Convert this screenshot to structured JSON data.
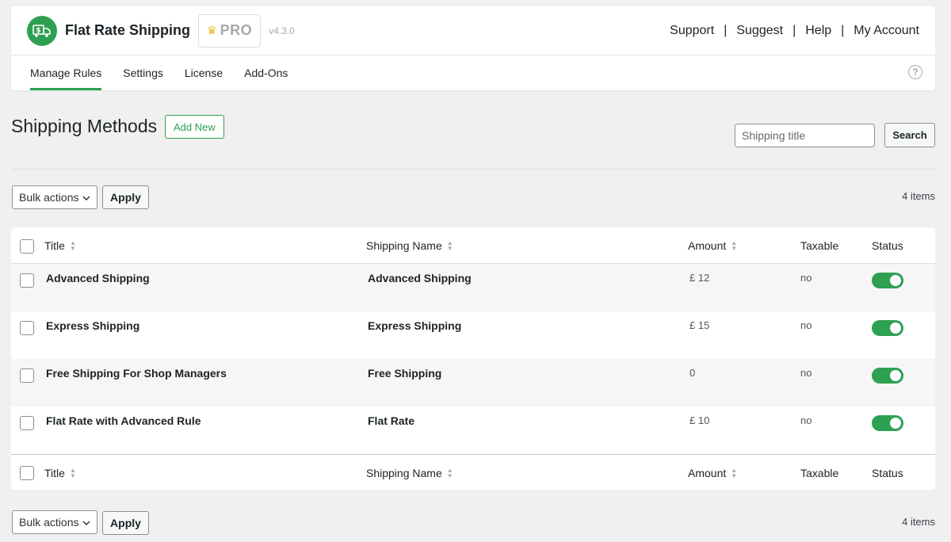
{
  "header": {
    "app_title": "Flat Rate Shipping",
    "pro_label": "PRO",
    "version": "v4.3.0",
    "links": [
      "Support",
      "Suggest",
      "Help",
      "My Account"
    ],
    "tabs": [
      "Manage Rules",
      "Settings",
      "License",
      "Add-Ons"
    ],
    "active_tab": "Manage Rules",
    "help_glyph": "?"
  },
  "colors": {
    "accent": "#2ea052",
    "crown": "#f0b323"
  },
  "icons": {
    "logo": "shipping-truck-dollar-icon",
    "help": "question-circle-icon",
    "sort": "sort-arrows-icon",
    "dropdown": "chevron-down-icon",
    "crown": "crown-icon"
  },
  "page": {
    "title": "Shipping Methods",
    "add_new": "Add New",
    "search_placeholder": "Shipping title",
    "search_button": "Search"
  },
  "bulk": {
    "select_label": "Bulk actions",
    "apply_label": "Apply",
    "items_count": "4 items"
  },
  "table": {
    "columns": {
      "title": "Title",
      "shipping_name": "Shipping Name",
      "amount": "Amount",
      "taxable": "Taxable",
      "status": "Status"
    },
    "rows": [
      {
        "title": "Advanced Shipping",
        "shipping_name": "Advanced Shipping",
        "amount": "£ 12",
        "taxable": "no",
        "status_on": true
      },
      {
        "title": "Express Shipping",
        "shipping_name": "Express Shipping",
        "amount": "£ 15",
        "taxable": "no",
        "status_on": true
      },
      {
        "title": "Free Shipping For Shop Managers",
        "shipping_name": "Free Shipping",
        "amount": "0",
        "taxable": "no",
        "status_on": true
      },
      {
        "title": "Flat Rate with Advanced Rule",
        "shipping_name": "Flat Rate",
        "amount": "£ 10",
        "taxable": "no",
        "status_on": true
      }
    ]
  }
}
